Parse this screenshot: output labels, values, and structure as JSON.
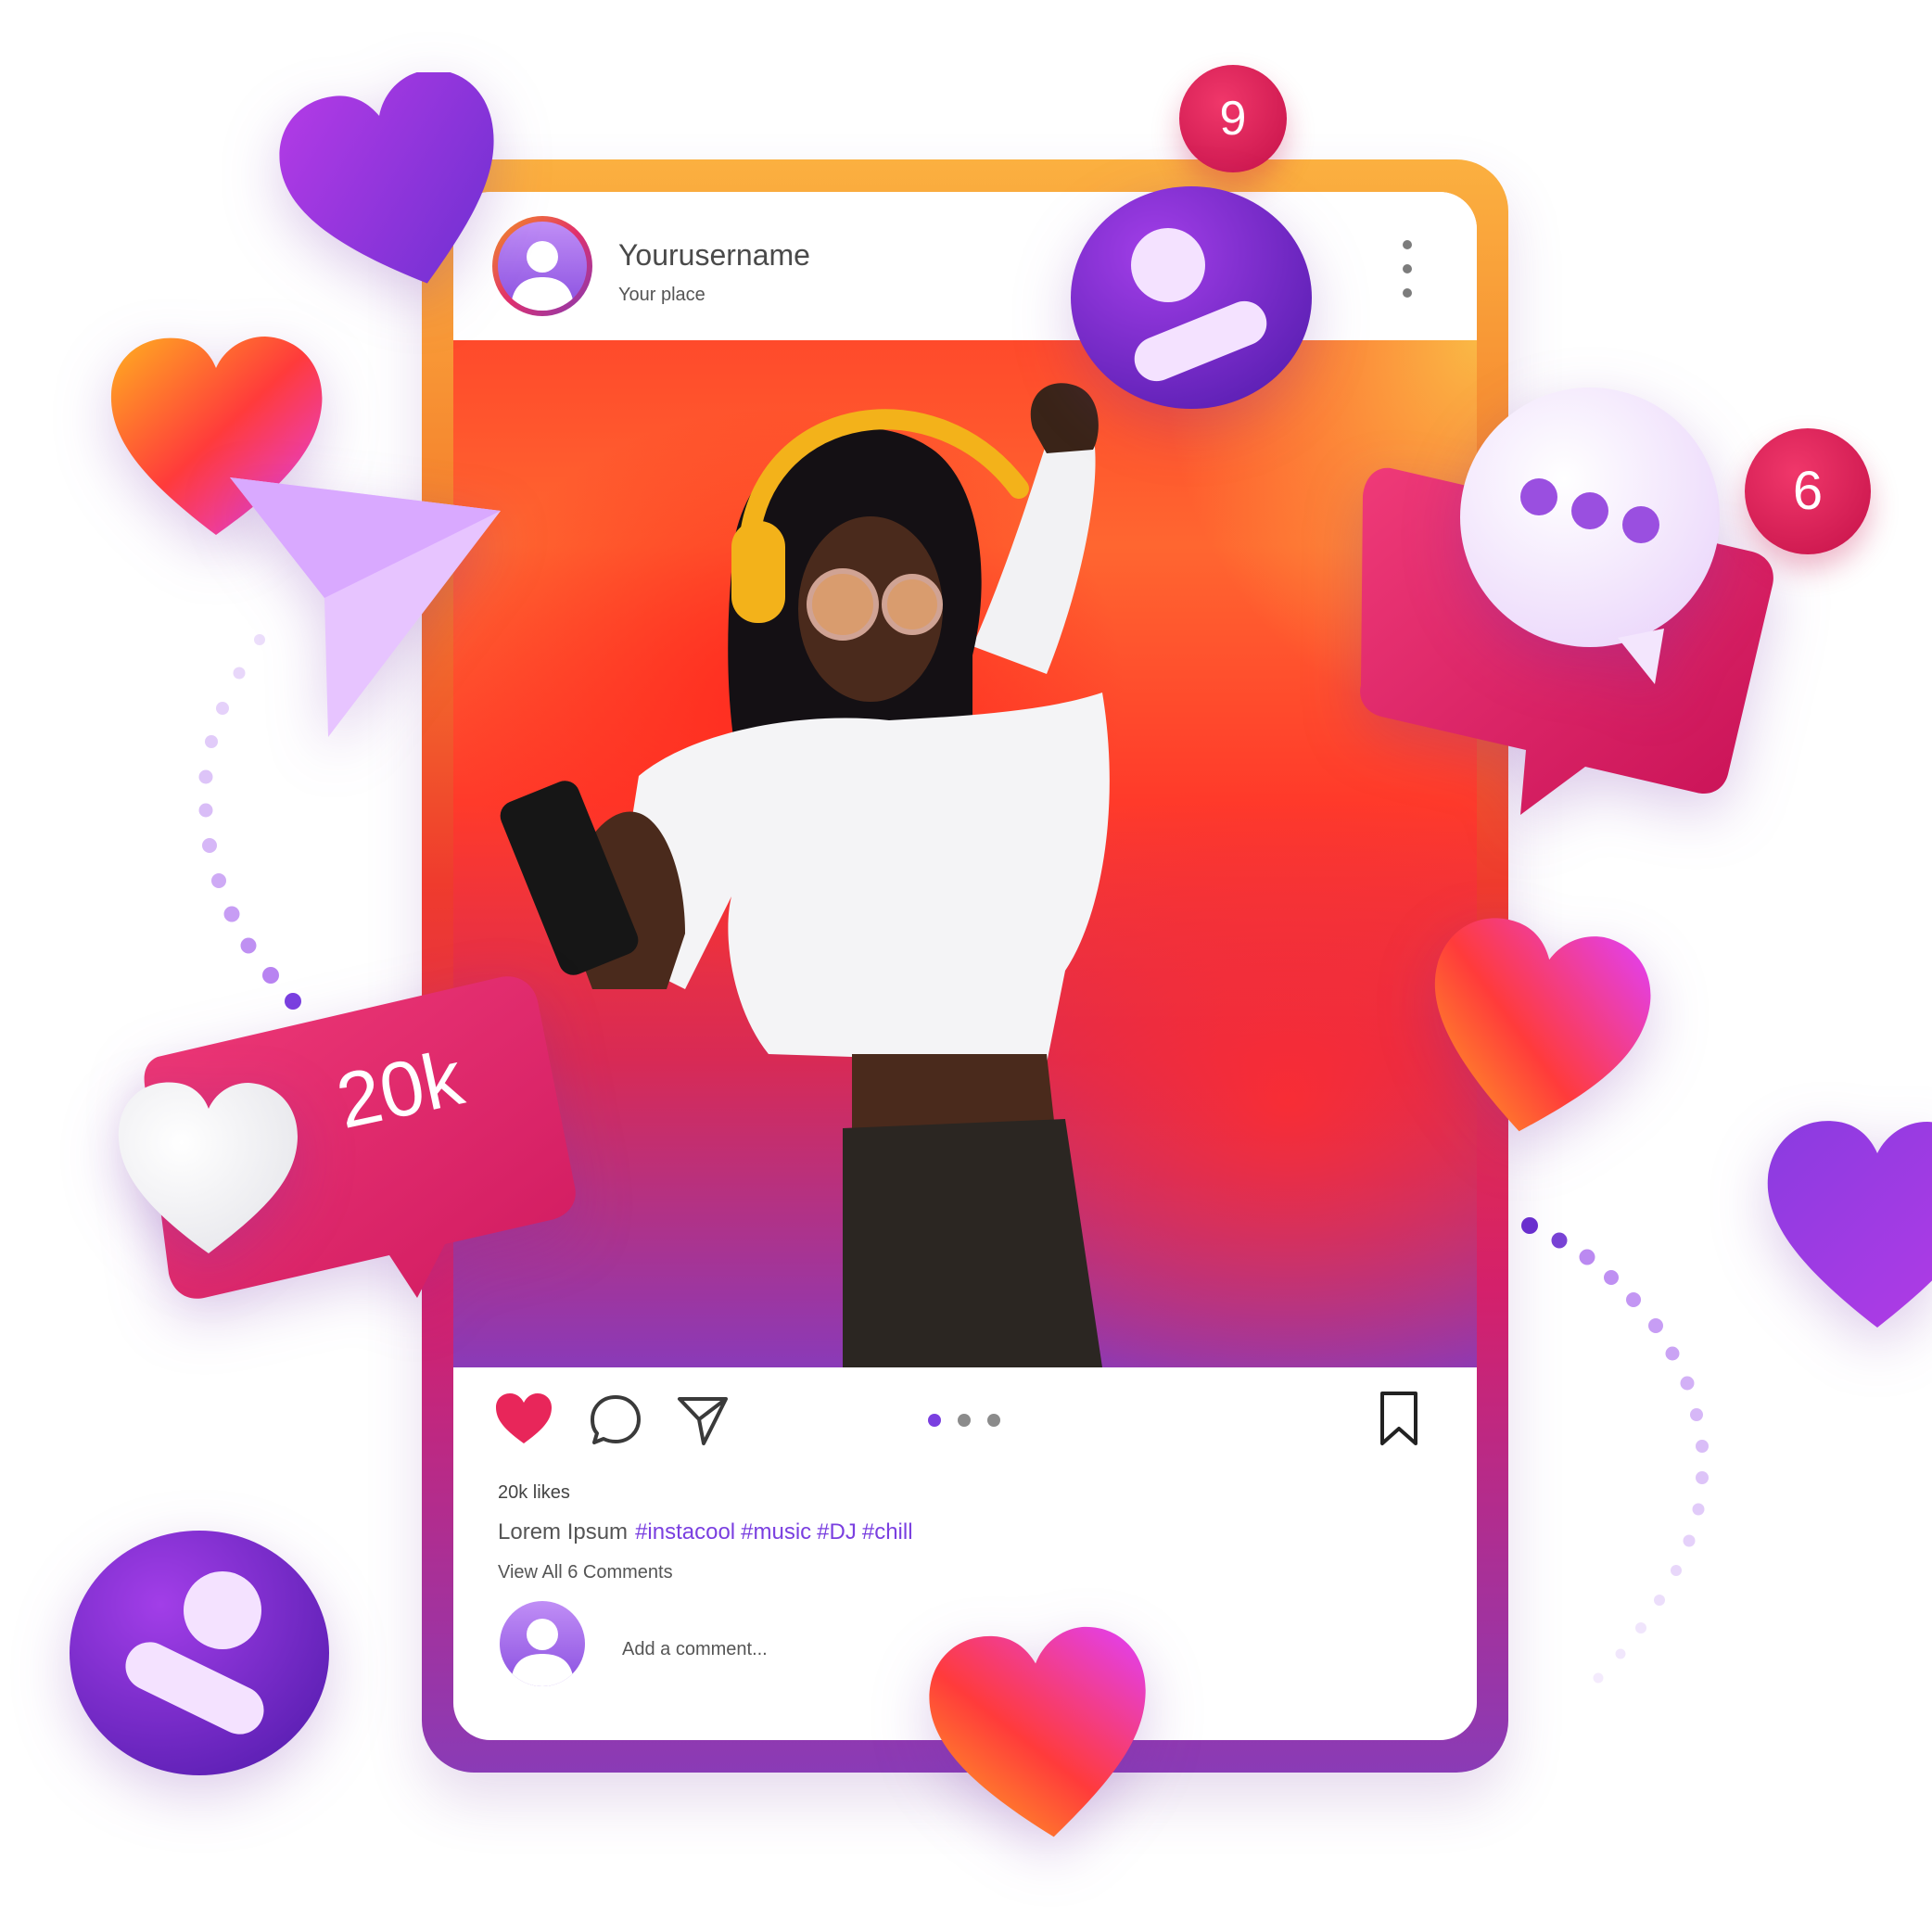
{
  "post": {
    "username": "Yourusername",
    "location": "Your place",
    "likes_text": "20k likes",
    "caption_text": "Lorem Ipsum",
    "hashtags": [
      "#instacool",
      "#music",
      "#DJ",
      "#chill"
    ],
    "comments_link": "View All 6 Comments",
    "comment_placeholder": "Add a comment...",
    "carousel_dots": 3,
    "carousel_active_index": 0
  },
  "floating": {
    "likes_badge": "20k",
    "notification_badge_top": "9",
    "comment_badge_count": "6"
  },
  "colors": {
    "heart_red": "#e8265a",
    "hashtag_purple": "#7a3fe0",
    "badge_pink": "#e0245e",
    "avatar_purple": "#8a4fe0",
    "frame_top": "#fbb040",
    "frame_bottom": "#8a3bb6"
  },
  "icons": [
    "more-vertical-icon",
    "heart-icon",
    "comment-icon",
    "send-icon",
    "bookmark-icon",
    "user-icon",
    "chat-dots-icon",
    "paper-plane-icon"
  ]
}
